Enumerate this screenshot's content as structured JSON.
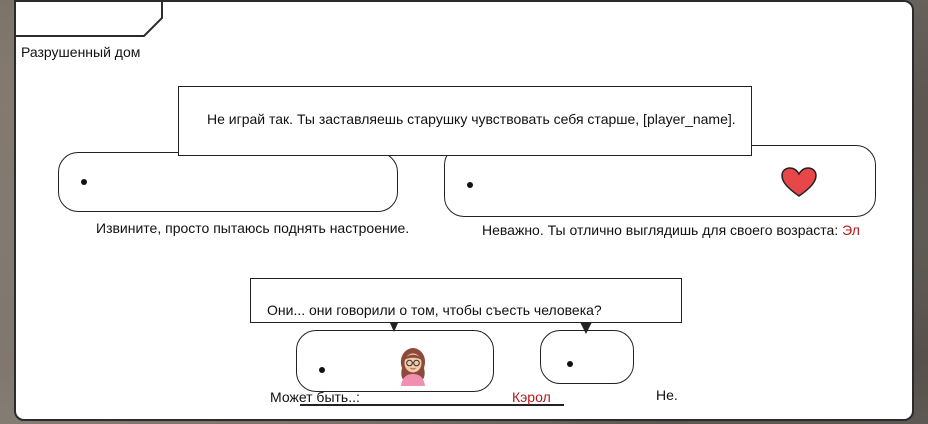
{
  "location": "Разрушенный дом",
  "speech": [
    {
      "text": "Не играй так. Ты заставляешь старушку чувствовать себя старше, [player_name]."
    },
    {
      "text": "Они... они говорили о том, чтобы съесть человека?"
    }
  ],
  "choices": [
    {
      "label": "Извините, просто пытаюсь поднять настроение."
    },
    {
      "label": "Неважно. Ты отлично выглядишь для своего возраста:",
      "speaker": "Эл",
      "icon": "heart-icon"
    },
    {
      "label": "Может быть..:",
      "speaker": "Кэрол",
      "icon": "avatar-carol"
    },
    {
      "label": "Не."
    }
  ],
  "colors": {
    "speaker": "#b01a1a",
    "heart": "#e8474a",
    "panel_border": "#2b2b2b"
  }
}
